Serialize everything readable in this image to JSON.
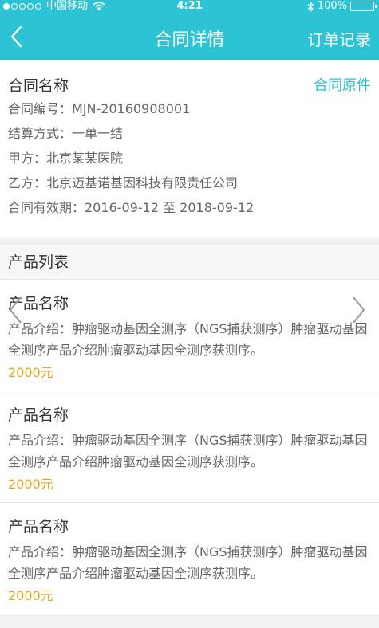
{
  "status": {
    "carrier": "中国移动",
    "time": "4:21",
    "battery": "100%",
    "battery_level": 1.0
  },
  "nav": {
    "title": "合同详情",
    "orders_label": "订单记录"
  },
  "contract": {
    "name_label": "合同名称",
    "original_label": "合同原件",
    "number": "合同编号：MJN-20160908001",
    "settlement": "结算方式：一单一结",
    "party_a": "甲方：北京某某医院",
    "party_b": "乙方：北京迈基诺基因科技有限责任公司",
    "validity": "合同有效期：2016-09-12 至 2018-09-12"
  },
  "product_list": {
    "header": "产品列表",
    "items": [
      {
        "name": "产品名称",
        "desc": "产品介绍：肿瘤驱动基因全测序（NGS捕获测序）肿瘤驱动基因全测序产品介绍肿瘤驱动基因全测序获测序。",
        "price": "2000元"
      },
      {
        "name": "产品名称",
        "desc": "产品介绍：肿瘤驱动基因全测序（NGS捕获测序）肿瘤驱动基因全测序产品介绍肿瘤驱动基因全测序获测序。",
        "price": "2000元"
      },
      {
        "name": "产品名称",
        "desc": "产品介绍：肿瘤驱动基因全测序（NGS捕获测序）肿瘤驱动基因全测序产品介绍肿瘤驱动基因全测序获测序。",
        "price": "2000元"
      }
    ]
  },
  "colors": {
    "accent": "#2cc3d4",
    "price": "#e8a31c"
  },
  "icons": {
    "back": "chevron-left-icon",
    "prev": "chevron-left-icon",
    "next": "chevron-right-icon"
  }
}
